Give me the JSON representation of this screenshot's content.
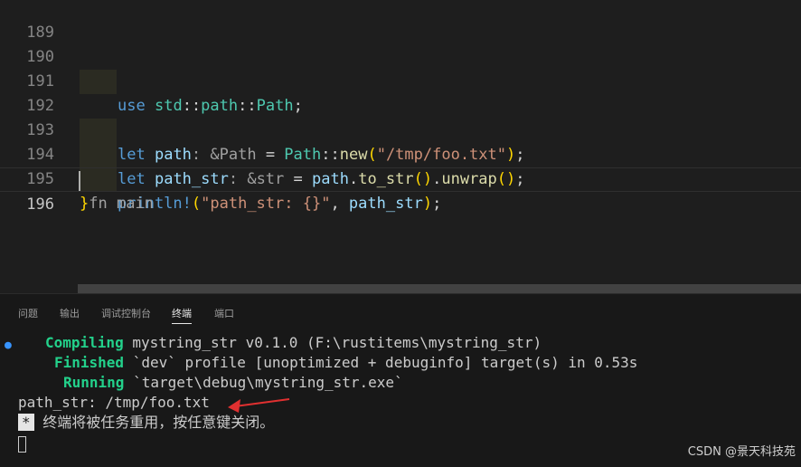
{
  "editor": {
    "lines": [
      {
        "num": "189"
      },
      {
        "num": "190",
        "tokens": [
          "use",
          "std",
          "::",
          "path",
          "::",
          "Path",
          ";"
        ]
      },
      {
        "num": "191"
      },
      {
        "num": "192",
        "tokens": [
          "let",
          "path",
          ": &Path",
          " = ",
          "Path",
          "::",
          "new",
          "(",
          "\"/tmp/foo.txt\"",
          ")",
          ";"
        ]
      },
      {
        "num": "193",
        "tokens": [
          "let",
          "path_str",
          ": &str",
          " = ",
          "path",
          ".",
          "to_str",
          "()",
          ".",
          "unwrap",
          "()",
          ";"
        ]
      },
      {
        "num": "194",
        "tokens": [
          "println!",
          "(",
          "\"path_str: {}\"",
          ", ",
          "path_str",
          ")",
          ";"
        ]
      },
      {
        "num": "195",
        "tokens": [
          "}",
          "fn main"
        ]
      },
      {
        "num": "196"
      }
    ]
  },
  "panel": {
    "tabs": [
      "问题",
      "输出",
      "调试控制台",
      "终端",
      "端口"
    ],
    "active_tab": "终端",
    "terminal": {
      "compiling_label": "Compiling",
      "compiling_text": "mystring_str v0.1.0 (F:\\rustitems\\mystring_str)",
      "finished_label": "Finished",
      "finished_text": "`dev` profile [unoptimized + debuginfo] target(s) in 0.53s",
      "running_label": "Running",
      "running_text": "`target\\debug\\mystring_str.exe`",
      "output_line": "path_str: /tmp/foo.txt",
      "star": "*",
      "reuse_message": "终端将被任务重用，按任意键关闭。"
    }
  },
  "watermark": "CSDN @景天科技苑",
  "colors": {
    "keyword": "#569cd6",
    "type": "#4ec9b0",
    "string": "#ce9178",
    "terminal_green": "#23d18b",
    "arrow": "#e03030"
  }
}
